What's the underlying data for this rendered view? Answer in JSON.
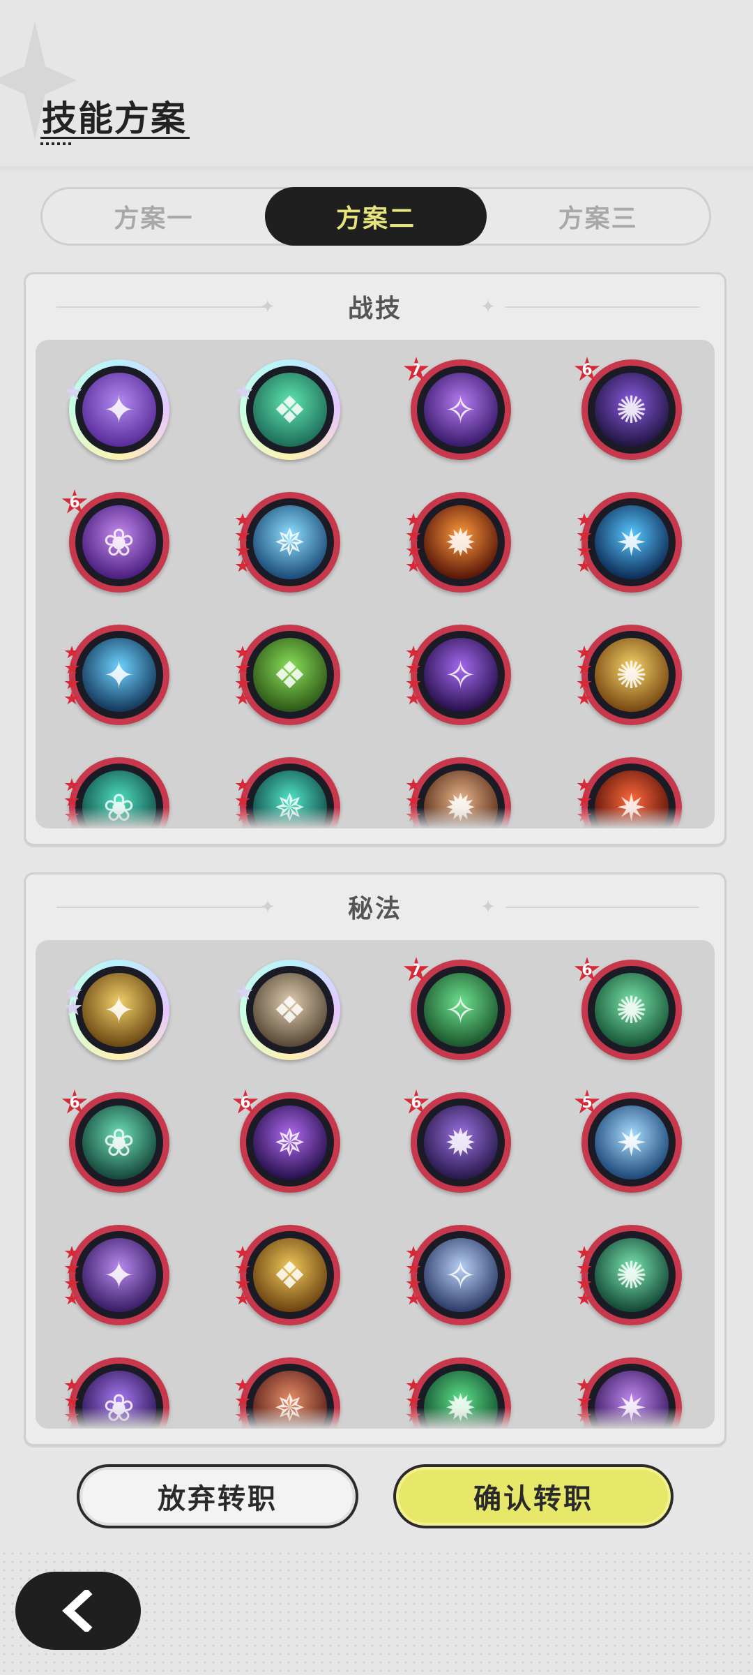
{
  "header": {
    "title": "技能方案"
  },
  "tabs": [
    {
      "label": "方案一",
      "active": false
    },
    {
      "label": "方案二",
      "active": true
    },
    {
      "label": "方案三",
      "active": false
    }
  ],
  "combat_skills": {
    "title": "战技",
    "items": [
      {
        "icon": "purple-totem-icon",
        "colors": [
          "#b38af0",
          "#5a2e9c"
        ],
        "ring": "prism",
        "mark": "prism-star"
      },
      {
        "icon": "green-spirit-icon",
        "colors": [
          "#5fe6b0",
          "#1f6f5a"
        ],
        "ring": "prism",
        "mark": "prism-star"
      },
      {
        "icon": "purple-rune-icon",
        "colors": [
          "#b57bf0",
          "#3b1c6e"
        ],
        "ring": "red",
        "mark": "7"
      },
      {
        "icon": "void-portal-icon",
        "colors": [
          "#8a5be0",
          "#231645"
        ],
        "ring": "red",
        "mark": "6"
      },
      {
        "icon": "purple-flower-icon",
        "colors": [
          "#c58bef",
          "#4b2080"
        ],
        "ring": "red",
        "mark": "6"
      },
      {
        "icon": "ice-burst-icon",
        "colors": [
          "#8fe0ff",
          "#1d4d7a"
        ],
        "ring": "red",
        "mark": "rank4"
      },
      {
        "icon": "fire-swirl-icon",
        "colors": [
          "#ff9a3d",
          "#5a1808"
        ],
        "ring": "red",
        "mark": "rank4"
      },
      {
        "icon": "blue-flame-icon",
        "colors": [
          "#58c8ff",
          "#0e2e5a"
        ],
        "ring": "red",
        "mark": "rank4"
      },
      {
        "icon": "ice-crystal-icon",
        "colors": [
          "#6fd3ff",
          "#153a5e"
        ],
        "ring": "red",
        "mark": "rank4"
      },
      {
        "icon": "tree-stump-icon",
        "colors": [
          "#8be05a",
          "#2f5a18"
        ],
        "ring": "red",
        "mark": "rank4"
      },
      {
        "icon": "star-flash-icon",
        "colors": [
          "#a56af0",
          "#2a1250"
        ],
        "ring": "red",
        "mark": "rank4"
      },
      {
        "icon": "golden-fist-icon",
        "colors": [
          "#f5d36a",
          "#7a4a12"
        ],
        "ring": "red",
        "mark": "rank4"
      },
      {
        "icon": "teal-wave-icon",
        "colors": [
          "#4fe0c0",
          "#125048"
        ],
        "ring": "red",
        "mark": "rank4"
      },
      {
        "icon": "teal-vortex-icon",
        "colors": [
          "#52e6c8",
          "#104a46"
        ],
        "ring": "red",
        "mark": "rank4"
      },
      {
        "icon": "rock-shard-icon",
        "colors": [
          "#e8b58a",
          "#5a2e1a"
        ],
        "ring": "red",
        "mark": "rank4"
      },
      {
        "icon": "red-fire-icon",
        "colors": [
          "#ff6a3d",
          "#5a1208"
        ],
        "ring": "red",
        "mark": "rank4"
      }
    ]
  },
  "arcane_skills": {
    "title": "秘法",
    "items": [
      {
        "icon": "golden-guardian-icon",
        "colors": [
          "#f0cf6a",
          "#6e4b14"
        ],
        "ring": "prism",
        "mark": "prism-star2"
      },
      {
        "icon": "stone-guardian-icon",
        "colors": [
          "#e0cdb0",
          "#5a4a38"
        ],
        "ring": "prism",
        "mark": "prism-star"
      },
      {
        "icon": "green-totem-icon",
        "colors": [
          "#6fe08f",
          "#1c5a2e"
        ],
        "ring": "red",
        "mark": "7"
      },
      {
        "icon": "green-wings-icon",
        "colors": [
          "#7ae3a8",
          "#1a5a3a"
        ],
        "ring": "red",
        "mark": "6"
      },
      {
        "icon": "green-heal-icon",
        "colors": [
          "#6fe0b8",
          "#164a3c"
        ],
        "ring": "red",
        "mark": "6"
      },
      {
        "icon": "purple-orb-icon",
        "colors": [
          "#b06af0",
          "#2a1250"
        ],
        "ring": "red",
        "mark": "6"
      },
      {
        "icon": "purple-arm-icon",
        "colors": [
          "#9a72e0",
          "#2a1a4e"
        ],
        "ring": "red",
        "mark": "6"
      },
      {
        "icon": "ice-shield-icon",
        "colors": [
          "#a8dcff",
          "#1f4a7a"
        ],
        "ring": "red",
        "mark": "5"
      },
      {
        "icon": "purple-heart-icon",
        "colors": [
          "#b98aef",
          "#3a1e66"
        ],
        "ring": "red",
        "mark": "rank4"
      },
      {
        "icon": "golden-hand-icon",
        "colors": [
          "#f0c85a",
          "#6e4512"
        ],
        "ring": "red",
        "mark": "rank4"
      },
      {
        "icon": "crystal-gem-icon",
        "colors": [
          "#b8d0f5",
          "#2e3e6a"
        ],
        "ring": "red",
        "mark": "rank4"
      },
      {
        "icon": "green-figure-icon",
        "colors": [
          "#7ae6b0",
          "#154a38"
        ],
        "ring": "red",
        "mark": "rank4"
      },
      {
        "icon": "purple-spell-icon",
        "colors": [
          "#a87af0",
          "#2e1658"
        ],
        "ring": "red",
        "mark": "rank4"
      },
      {
        "icon": "red-figure-icon",
        "colors": [
          "#e8906a",
          "#5a1e18"
        ],
        "ring": "red",
        "mark": "rank4"
      },
      {
        "icon": "green-heart-icon",
        "colors": [
          "#5fe08a",
          "#12502e"
        ],
        "ring": "red",
        "mark": "rank4"
      },
      {
        "icon": "purple-crown-icon",
        "colors": [
          "#c08af0",
          "#3a1a60"
        ],
        "ring": "red",
        "mark": "rank4"
      }
    ]
  },
  "actions": {
    "cancel": "放弃转职",
    "confirm": "确认转职"
  },
  "footer": {
    "back_icon": "chevron-left-icon"
  }
}
